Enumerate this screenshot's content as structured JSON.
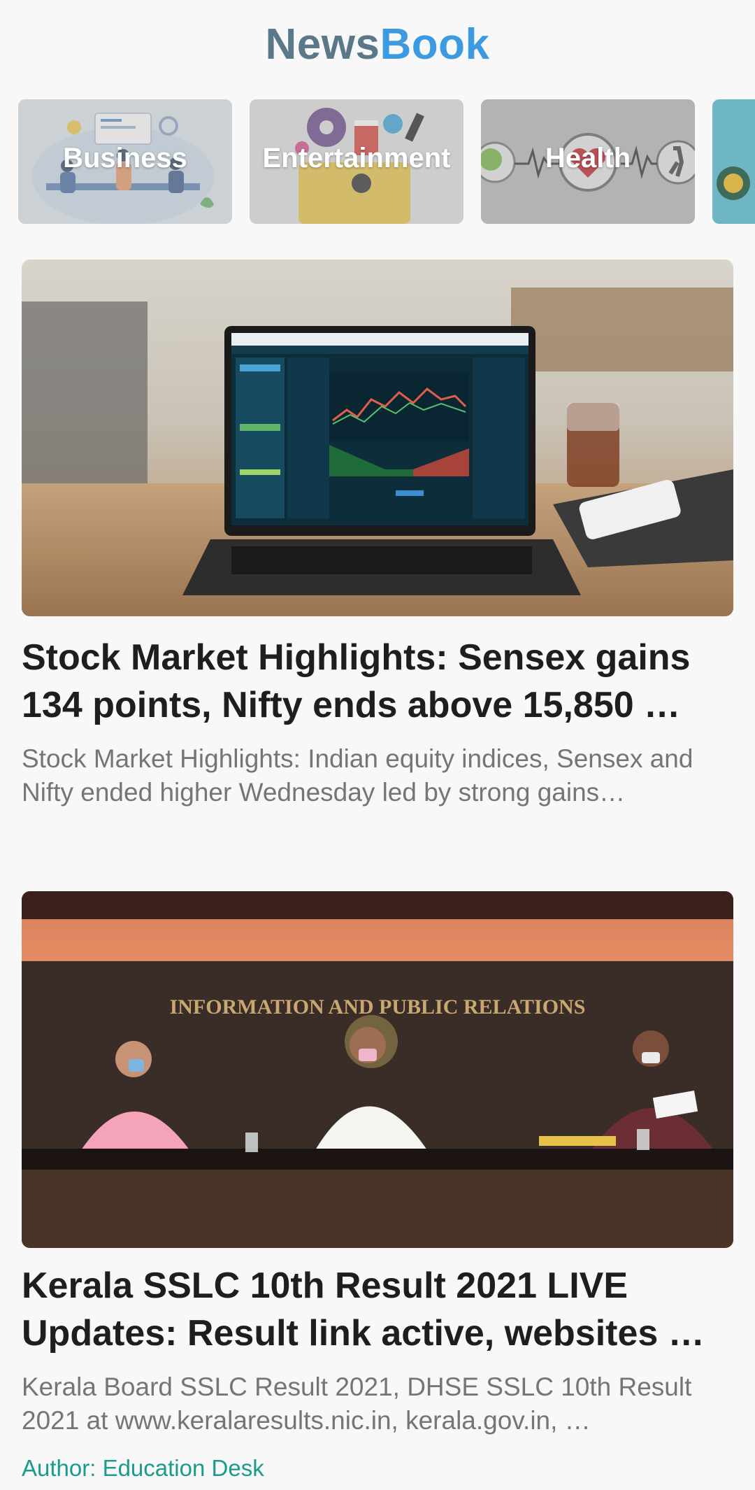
{
  "app": {
    "title_part1": "News",
    "title_part2": "Book"
  },
  "categories": [
    {
      "label": "Business",
      "art": "team-meeting-illustration"
    },
    {
      "label": "Entertainment",
      "art": "film-reel-popcorn-illustration"
    },
    {
      "label": "Health",
      "art": "heart-brain-heartbeat-illustration"
    },
    {
      "label": "",
      "art": "partially-visible-category"
    }
  ],
  "articles": [
    {
      "image": "laptop-stock-chart-photo",
      "title": "Stock Market Highlights: Sensex gains 134 points, Nifty ends above 15,850 …",
      "description": "Stock Market Highlights: Indian equity indices, Sensex and Nifty ended higher Wednesday led by strong gains…"
    },
    {
      "image": "press-conference-photo",
      "image_text": "INFORMATION AND PUBLIC RELATIONS",
      "title": "Kerala SSLC 10th Result 2021 LIVE Updates: Result link active, websites …",
      "description": "Kerala Board SSLC Result 2021, DHSE SSLC 10th Result 2021 at www.keralaresults.nic.in, kerala.gov.in, …",
      "author": "Author: Education Desk"
    }
  ],
  "colors": {
    "title_news": "#5b7889",
    "title_book": "#3c9be0",
    "author": "#1a9b8c",
    "background": "#f8f8f8"
  }
}
